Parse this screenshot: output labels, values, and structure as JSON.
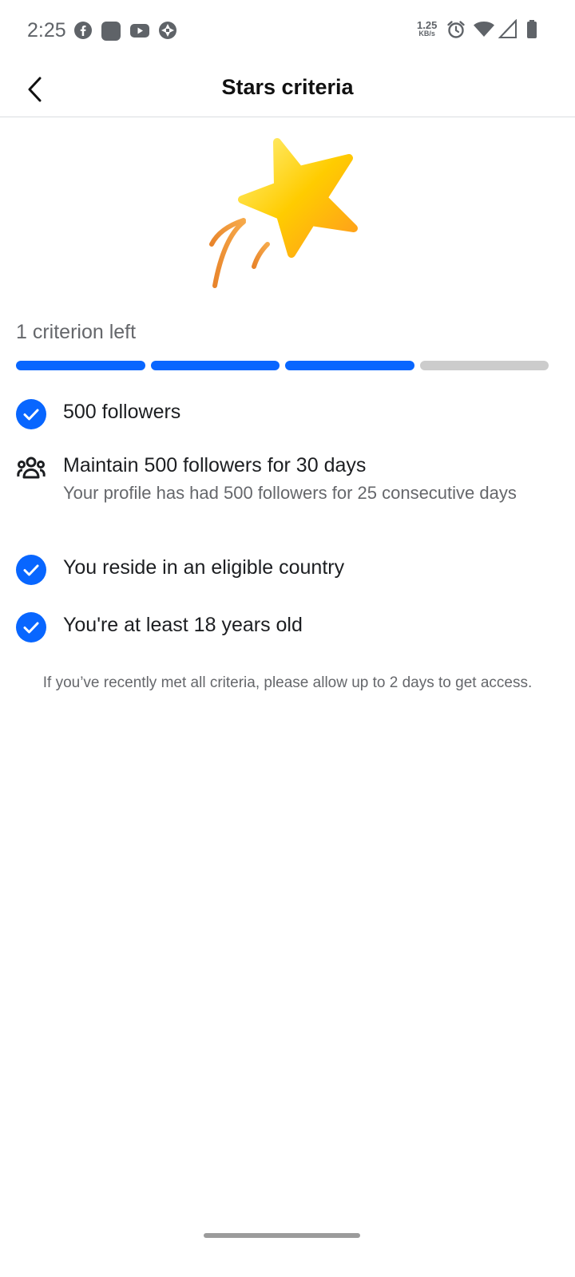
{
  "status_bar": {
    "time": "2:25",
    "net_speed_value": "1.25",
    "net_speed_unit": "KB/s",
    "left_icons": [
      "facebook-icon",
      "app-icon",
      "youtube-icon",
      "aperture-icon"
    ],
    "right_icons": [
      "alarm-icon",
      "wifi-icon",
      "signal-icon",
      "battery-icon"
    ]
  },
  "header": {
    "title": "Stars criteria",
    "back_icon": "chevron-left-icon"
  },
  "hero": {
    "icon": "shooting-star-icon"
  },
  "progress": {
    "label": "1 criterion left",
    "completed": 3,
    "total": 4,
    "accent_color": "#0866ff",
    "track_color": "#cccccc"
  },
  "criteria": [
    {
      "title": "500 followers",
      "status": "met",
      "icon": "check-circle-icon"
    },
    {
      "title": "Maintain 500 followers for 30 days",
      "description": "Your profile has had 500 followers for 25 consecutive days",
      "status": "in-progress",
      "icon": "people-icon"
    },
    {
      "title": "You reside in an eligible country",
      "status": "met",
      "icon": "check-circle-icon"
    },
    {
      "title": "You're at least 18 years old",
      "status": "met",
      "icon": "check-circle-icon"
    }
  ],
  "footnote": "If you’ve recently met all criteria, please allow up to 2 days to get access."
}
